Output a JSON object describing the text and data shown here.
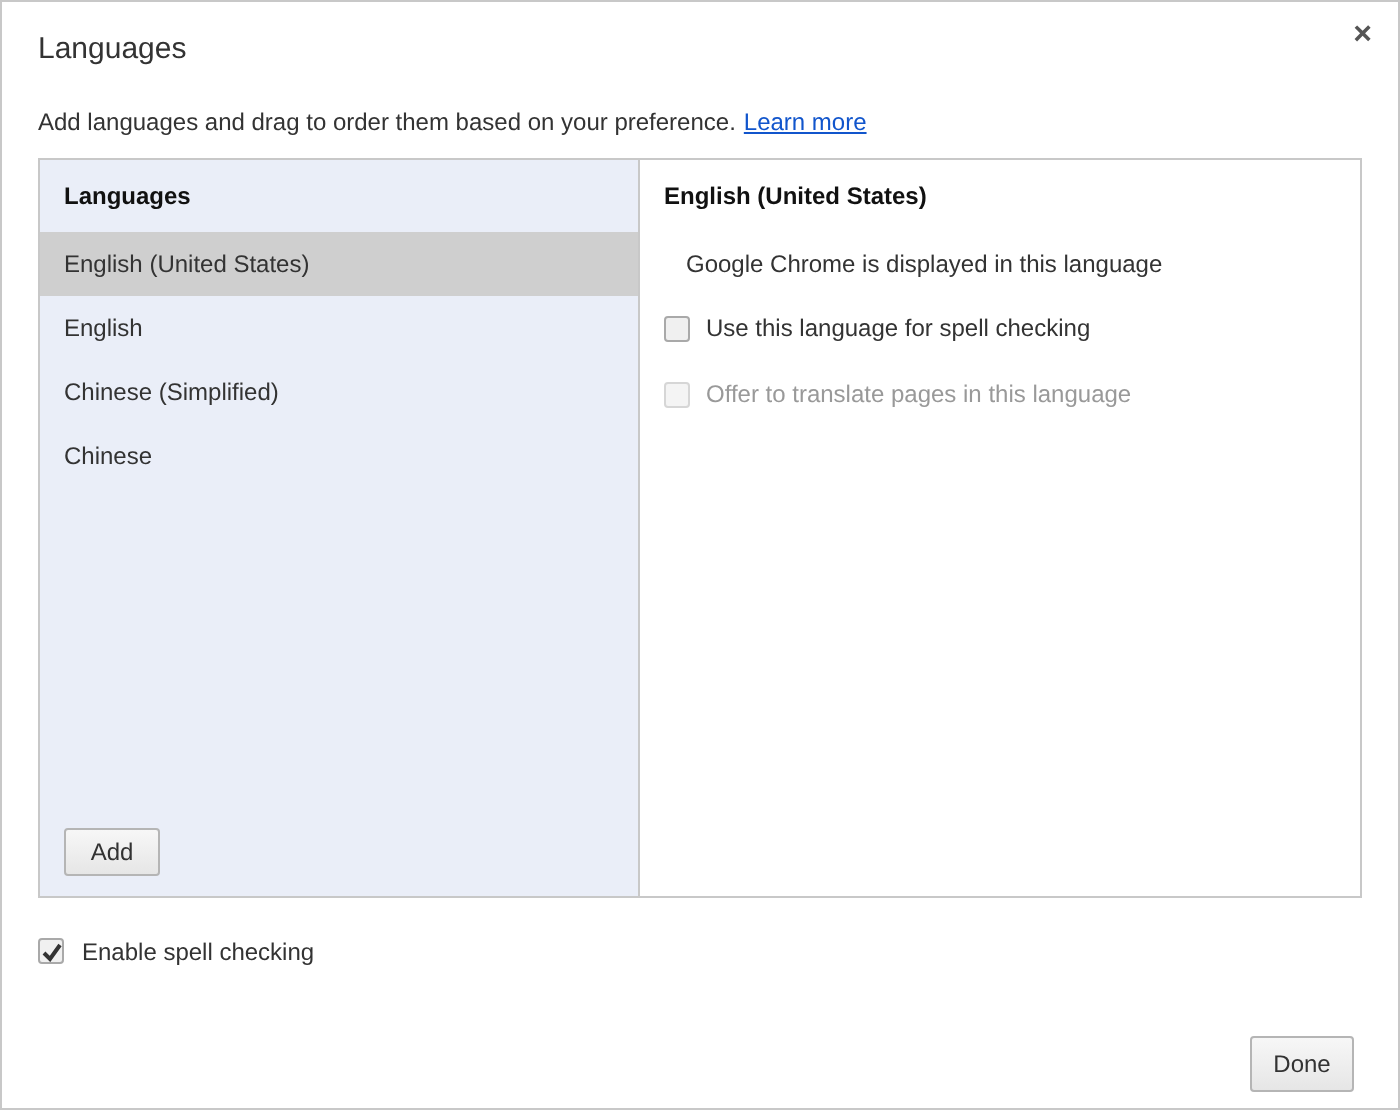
{
  "dialog": {
    "title": "Languages",
    "close": "×",
    "description": "Add languages and drag to order them based on your preference.",
    "link": "Learn more"
  },
  "language_list": {
    "heading": "Languages",
    "items": [
      {
        "label": "English (United States)",
        "selected": true
      },
      {
        "label": "English",
        "selected": false
      },
      {
        "label": "Chinese (Simplified)",
        "selected": false
      },
      {
        "label": "Chinese",
        "selected": false
      }
    ],
    "add_button": "Add"
  },
  "details": {
    "heading": "English (United States)",
    "options": [
      {
        "kind": "note",
        "label": "Google Chrome is displayed in this language"
      },
      {
        "kind": "checkbox",
        "label": "Use this language for spell checking",
        "checked": false,
        "disabled": false
      },
      {
        "kind": "checkbox",
        "label": "Offer to translate pages in this language",
        "checked": false,
        "disabled": true
      }
    ]
  },
  "spell_check": {
    "label": "Enable spell checking",
    "checked": true
  },
  "buttons": [
    "Done"
  ]
}
